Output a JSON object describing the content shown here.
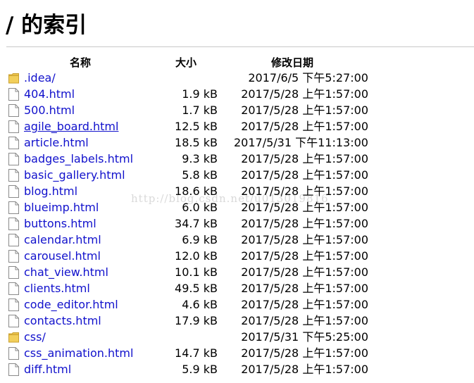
{
  "page": {
    "title": "/ 的索引"
  },
  "columns": {
    "name": "名称",
    "size": "大小",
    "modified": "修改日期"
  },
  "entries": [
    {
      "name": ".idea/",
      "type": "folder",
      "size": "",
      "modified": "2017/6/5 下午5:27:00"
    },
    {
      "name": "404.html",
      "type": "file",
      "size": "1.9 kB",
      "modified": "2017/5/28 上午1:57:00"
    },
    {
      "name": "500.html",
      "type": "file",
      "size": "1.7 kB",
      "modified": "2017/5/28 上午1:57:00"
    },
    {
      "name": "agile_board.html",
      "type": "file",
      "size": "12.5 kB",
      "modified": "2017/5/28 上午1:57:00"
    },
    {
      "name": "article.html",
      "type": "file",
      "size": "18.5 kB",
      "modified": "2017/5/31 下午11:13:00"
    },
    {
      "name": "badges_labels.html",
      "type": "file",
      "size": "9.3 kB",
      "modified": "2017/5/28 上午1:57:00"
    },
    {
      "name": "basic_gallery.html",
      "type": "file",
      "size": "5.8 kB",
      "modified": "2017/5/28 上午1:57:00"
    },
    {
      "name": "blog.html",
      "type": "file",
      "size": "18.6 kB",
      "modified": "2017/5/28 上午1:57:00"
    },
    {
      "name": "blueimp.html",
      "type": "file",
      "size": "6.0 kB",
      "modified": "2017/5/28 上午1:57:00"
    },
    {
      "name": "buttons.html",
      "type": "file",
      "size": "34.7 kB",
      "modified": "2017/5/28 上午1:57:00"
    },
    {
      "name": "calendar.html",
      "type": "file",
      "size": "6.9 kB",
      "modified": "2017/5/28 上午1:57:00"
    },
    {
      "name": "carousel.html",
      "type": "file",
      "size": "12.0 kB",
      "modified": "2017/5/28 上午1:57:00"
    },
    {
      "name": "chat_view.html",
      "type": "file",
      "size": "10.1 kB",
      "modified": "2017/5/28 上午1:57:00"
    },
    {
      "name": "clients.html",
      "type": "file",
      "size": "49.5 kB",
      "modified": "2017/5/28 上午1:57:00"
    },
    {
      "name": "code_editor.html",
      "type": "file",
      "size": "4.6 kB",
      "modified": "2017/5/28 上午1:57:00"
    },
    {
      "name": "contacts.html",
      "type": "file",
      "size": "17.9 kB",
      "modified": "2017/5/28 上午1:57:00"
    },
    {
      "name": "css/",
      "type": "folder",
      "size": "",
      "modified": "2017/5/31 下午5:25:00"
    },
    {
      "name": "css_animation.html",
      "type": "file",
      "size": "14.7 kB",
      "modified": "2017/5/28 上午1:57:00"
    },
    {
      "name": "diff.html",
      "type": "file",
      "size": "5.9 kB",
      "modified": "2017/5/28 上午1:57:00"
    }
  ],
  "hovered_entry": "agile_board.html",
  "watermark": "http://blog.csdn.net/u013019816",
  "colors": {
    "link": "#1111cc",
    "folder": "#e8c04a",
    "rule": "#c8c8c8"
  }
}
